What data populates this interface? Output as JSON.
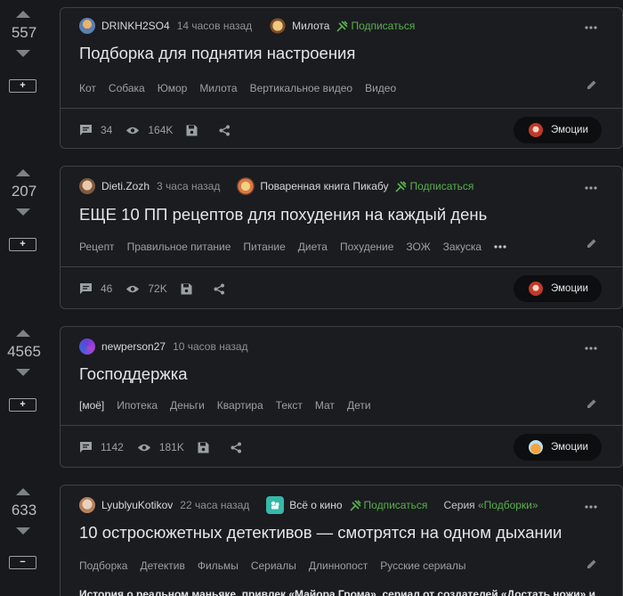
{
  "posts": [
    {
      "rating": "557",
      "expand_label": "+",
      "author": "DRINKH2SO4",
      "time": "14 часов назад",
      "community": "Милота",
      "subscribe": "Подписаться",
      "title": "Подборка для поднятия настроения",
      "tags": [
        "Кот",
        "Собака",
        "Юмор",
        "Милота",
        "Вертикальное видео",
        "Видео"
      ],
      "comments": "34",
      "views": "164K",
      "emotions_label": "Эмоции"
    },
    {
      "rating": "207",
      "expand_label": "+",
      "author": "Dieti.Zozh",
      "time": "3 часа назад",
      "community": "Поваренная книга Пикабу",
      "subscribe": "Подписаться",
      "title": "ЕЩЕ 10 ПП рецептов для похудения на каждый день",
      "tags": [
        "Рецепт",
        "Правильное питание",
        "Питание",
        "Диета",
        "Похудение",
        "ЗОЖ",
        "Закуска"
      ],
      "comments": "46",
      "views": "72K",
      "emotions_label": "Эмоции"
    },
    {
      "rating": "4565",
      "expand_label": "+",
      "author": "newperson27",
      "time": "10 часов назад",
      "title": "Господдержка",
      "tags": [
        "[моё]",
        "Ипотека",
        "Деньги",
        "Квартира",
        "Текст",
        "Мат",
        "Дети"
      ],
      "comments": "1142",
      "views": "181K",
      "emotions_label": "Эмоции"
    },
    {
      "rating": "633",
      "expand_label": "−",
      "author": "LyublyuKotikov",
      "time": "22 часа назад",
      "community": "Всё о кино",
      "subscribe": "Подписаться",
      "series_prefix": "Серия ",
      "series_name": "«Подборки»",
      "title": "10 остросюжетных детективов — смотрятся на одном дыхании",
      "tags": [
        "Подборка",
        "Детектив",
        "Фильмы",
        "Сериалы",
        "Длиннопост",
        "Русские сериалы"
      ],
      "body_preview": "История о реальном маньяке, привлек «Майора Грома», сериал от создателей «Достать ножи» и"
    }
  ],
  "colors": {
    "accent_green": "#5ab04d",
    "background": "#17191c",
    "card_border": "#3d4145"
  }
}
